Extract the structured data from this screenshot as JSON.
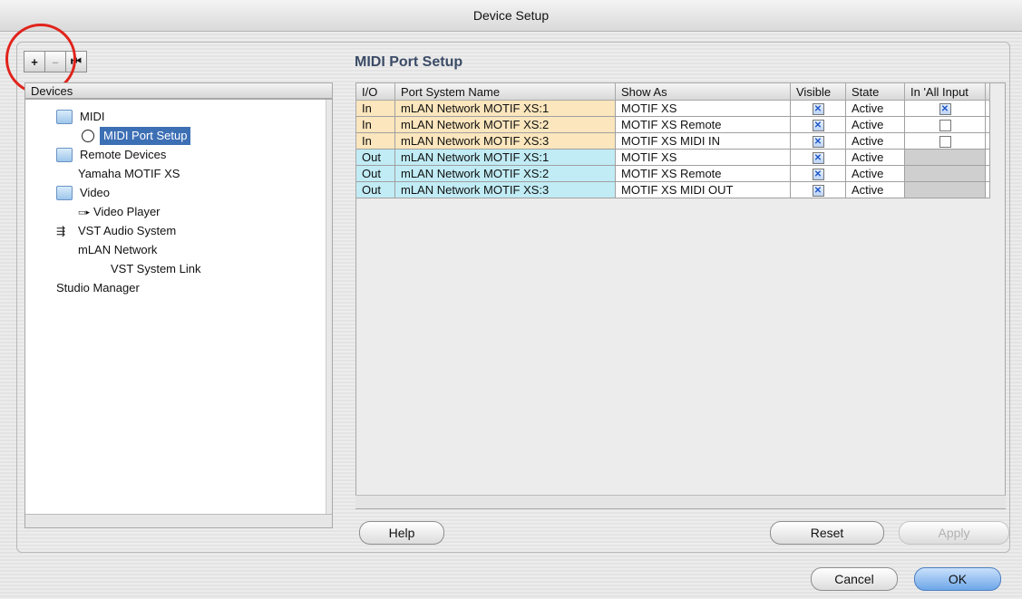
{
  "window": {
    "title": "Device Setup"
  },
  "toolbar": {
    "add_label": "+",
    "remove_label": "–",
    "reset_label": "⏮"
  },
  "devices_panel": {
    "header": "Devices",
    "items": [
      {
        "label": "MIDI"
      },
      {
        "label": "MIDI Port Setup"
      },
      {
        "label": "Remote Devices"
      },
      {
        "label": "Yamaha MOTIF XS"
      },
      {
        "label": "Video"
      },
      {
        "label": "Video Player"
      },
      {
        "label": "VST Audio System"
      },
      {
        "label": "mLAN Network"
      },
      {
        "label": "VST System Link"
      },
      {
        "label": "Studio Manager"
      }
    ]
  },
  "main": {
    "title": "MIDI Port Setup",
    "columns": [
      "I/O",
      "Port System Name",
      "Show As",
      "Visible",
      "State",
      "In 'All Input"
    ],
    "rows": [
      {
        "io": "In",
        "name": "mLAN Network MOTIF XS:1",
        "show_as": "MOTIF XS",
        "visible": true,
        "state": "Active",
        "all_input": "checked"
      },
      {
        "io": "In",
        "name": "mLAN Network MOTIF XS:2",
        "show_as": "MOTIF XS Remote",
        "visible": true,
        "state": "Active",
        "all_input": "unchecked"
      },
      {
        "io": "In",
        "name": "mLAN Network MOTIF XS:3",
        "show_as": "MOTIF XS MIDI IN",
        "visible": true,
        "state": "Active",
        "all_input": "unchecked"
      },
      {
        "io": "Out",
        "name": "mLAN Network MOTIF XS:1",
        "show_as": "MOTIF XS",
        "visible": true,
        "state": "Active",
        "all_input": "none"
      },
      {
        "io": "Out",
        "name": "mLAN Network MOTIF XS:2",
        "show_as": "MOTIF XS Remote",
        "visible": true,
        "state": "Active",
        "all_input": "none"
      },
      {
        "io": "Out",
        "name": "mLAN Network MOTIF XS:3",
        "show_as": "MOTIF XS MIDI OUT",
        "visible": true,
        "state": "Active",
        "all_input": "none"
      }
    ]
  },
  "buttons": {
    "help": "Help",
    "reset": "Reset",
    "apply": "Apply",
    "cancel": "Cancel",
    "ok": "OK"
  },
  "colors": {
    "in_row": "#fbe6bd",
    "out_row": "#c1ecf5",
    "selection": "#3d6fb5",
    "highlight_circle": "#e0231b",
    "title_blue": "#3b4b66"
  }
}
